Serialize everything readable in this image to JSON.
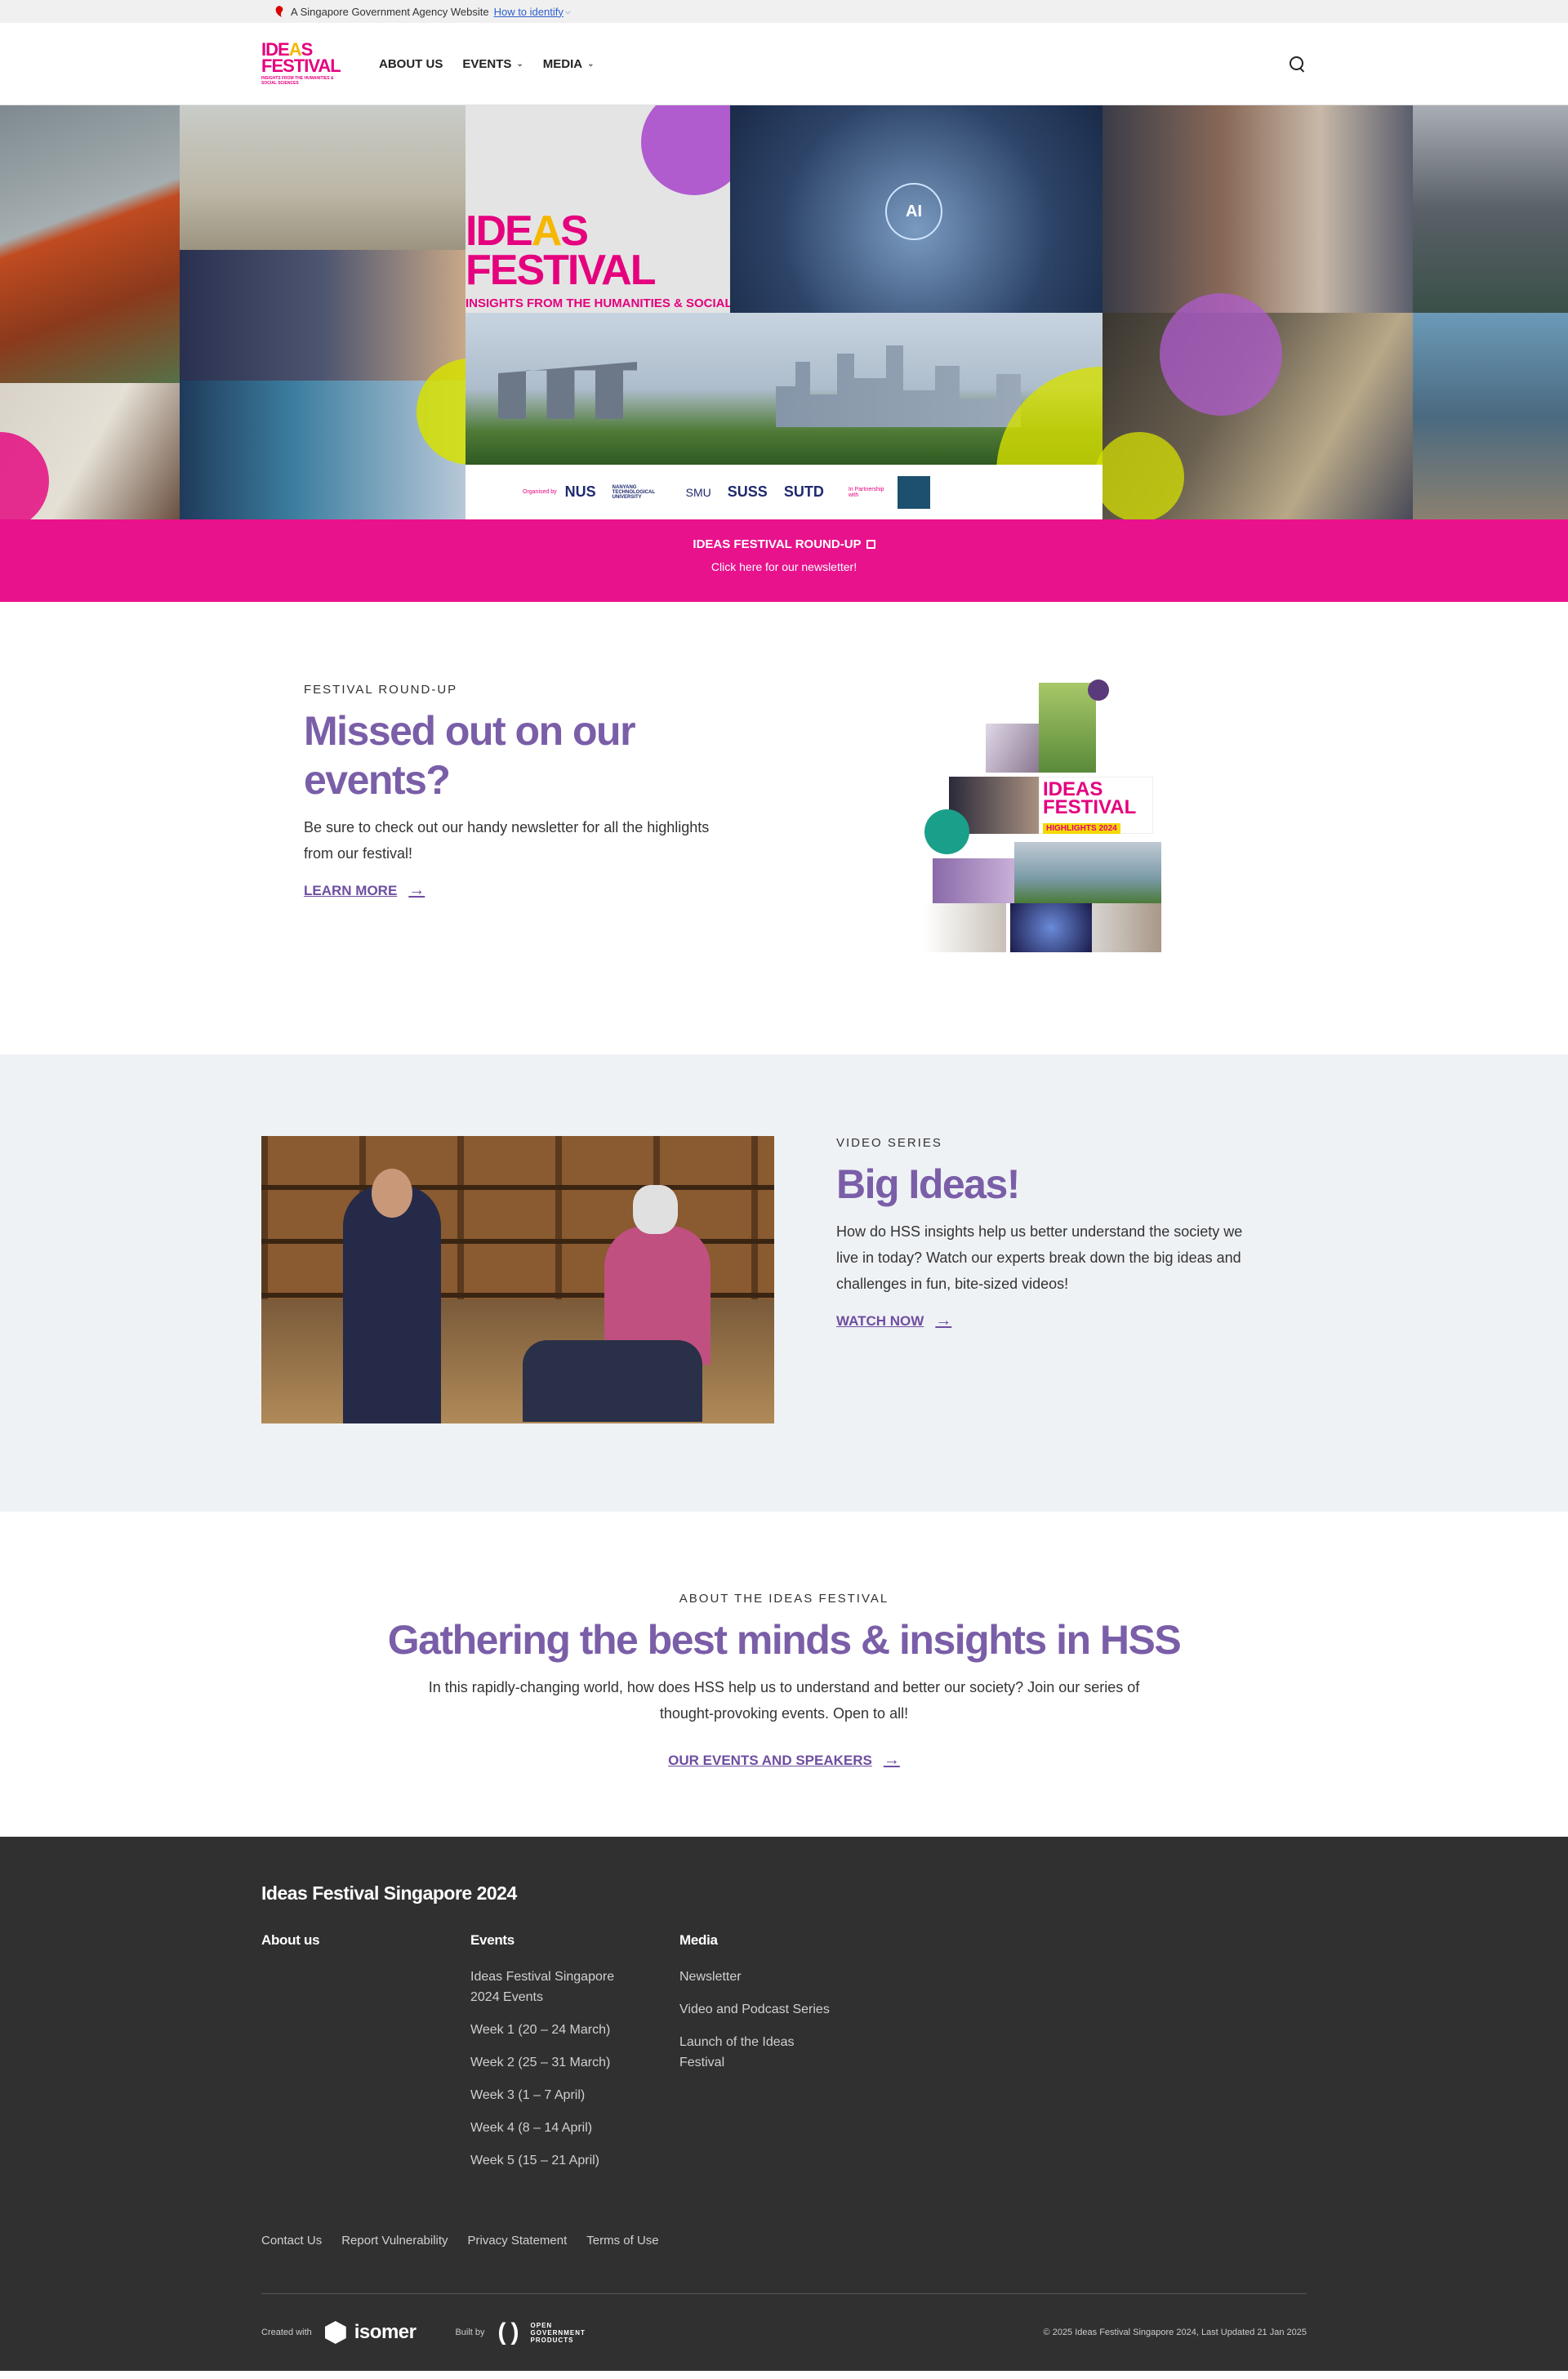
{
  "masthead": {
    "text": "A Singapore Government Agency Website",
    "identify_label": "How to identify"
  },
  "navbar": {
    "logo_line1_a": "IDE",
    "logo_line1_b": "A",
    "logo_line1_c": "S",
    "logo_line2": "FESTIVAL",
    "logo_tagline": "INSIGHTS FROM THE HUMANITIES & SOCIAL SCIENCES",
    "items": [
      {
        "label": "ABOUT US"
      },
      {
        "label": "EVENTS"
      },
      {
        "label": "MEDIA"
      }
    ]
  },
  "hero": {
    "title_a": "IDE",
    "title_b": "A",
    "title_c": "S",
    "title_line2": "FESTIVAL",
    "subtitle": "INSIGHTS FROM THE HUMANITIES & SOCIAL SCIENCES",
    "organised_by": "Organised by",
    "in_partnership": "In Partnership with",
    "partners": [
      "NUS",
      "NANYANG TECHNOLOGICAL UNIVERSITY",
      "SMU",
      "SUSS",
      "SUTD"
    ],
    "ai_label": "AI",
    "colors": {
      "magenta": "#e5007e",
      "yellow": "#d6e000",
      "purple": "#b05ccf"
    }
  },
  "banner": {
    "title": "IDEAS FESTIVAL ROUND-UP",
    "subtitle": "Click here for our newsletter!",
    "color": "#e8128c"
  },
  "roundup": {
    "eyebrow": "FESTIVAL ROUND-UP",
    "heading": "Missed out on our events?",
    "body": "Be sure to check out our handy newsletter for all the highlights from our festival!",
    "cta": "LEARN MORE",
    "mosaic_title": "IDEAS FESTIVAL",
    "mosaic_badge": "HIGHLIGHTS 2024"
  },
  "video": {
    "eyebrow": "VIDEO SERIES",
    "heading": "Big Ideas!",
    "body": "How do HSS insights help us better understand the society we live in today? Watch our experts break down the big ideas and challenges in fun, bite-sized videos!",
    "cta": "WATCH NOW"
  },
  "about": {
    "eyebrow": "ABOUT THE IDEAS FESTIVAL",
    "heading": "Gathering the best minds & insights in HSS",
    "body": "In this rapidly-changing world, how does HSS help us to understand and better our society? Join our series of thought-provoking events. Open to all!",
    "cta": "OUR EVENTS AND SPEAKERS"
  },
  "footer": {
    "title": "Ideas Festival Singapore 2024",
    "columns": [
      {
        "heading": "About us",
        "links": []
      },
      {
        "heading": "Events",
        "links": [
          "Ideas Festival Singapore 2024 Events",
          "Week 1 (20 – 24 March)",
          "Week 2 (25 – 31 March)",
          "Week 3 (1 – 7 April)",
          "Week 4 (8 – 14 April)",
          "Week 5 (15 – 21 April)"
        ]
      },
      {
        "heading": "Media",
        "links": [
          "Newsletter",
          "Video and Podcast Series",
          "Launch of the Ideas Festival"
        ]
      }
    ],
    "legal_links": [
      "Contact Us",
      "Report Vulnerability",
      "Privacy Statement",
      "Terms of Use"
    ],
    "created_with": "Created with",
    "isomer": "isomer",
    "built_by": "Built by",
    "ogp_line1": "OPEN",
    "ogp_line2": "GOVERNMENT",
    "ogp_line3": "PRODUCTS",
    "copyright": "© 2025 Ideas Festival Singapore 2024, Last Updated 21 Jan 2025"
  }
}
